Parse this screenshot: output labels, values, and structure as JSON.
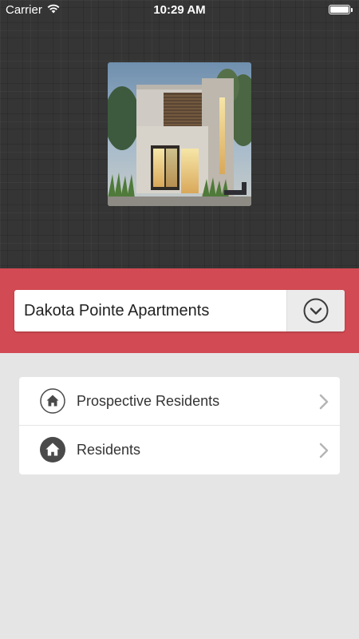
{
  "status_bar": {
    "carrier": "Carrier",
    "time": "10:29 AM",
    "wifi_icon": "wifi-icon",
    "battery_icon": "battery-icon"
  },
  "hero": {
    "image": "modern-building-photo"
  },
  "property_selector": {
    "value": "Dakota Pointe Apartments",
    "toggle_icon": "chevron-down-circle-icon"
  },
  "menu": {
    "items": [
      {
        "label": "Prospective Residents",
        "icon": "home-outline-icon"
      },
      {
        "label": "Residents",
        "icon": "home-filled-icon"
      }
    ]
  },
  "colors": {
    "hero_background": "#353535",
    "accent_band": "#d24a53",
    "page_background": "#e5e5e5",
    "card_background": "#ffffff"
  }
}
